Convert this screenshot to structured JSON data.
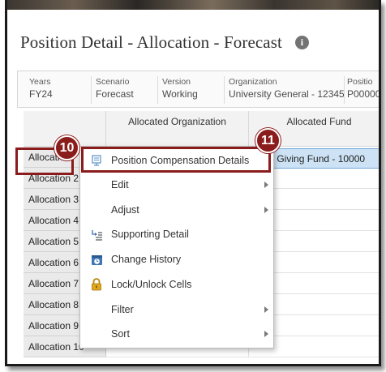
{
  "page_title": "Position Detail - Allocation - Forecast",
  "pov": [
    {
      "label": "Years",
      "value": "FY24"
    },
    {
      "label": "Scenario",
      "value": "Forecast"
    },
    {
      "label": "Version",
      "value": "Working"
    },
    {
      "label": "Organization",
      "value": "University General - 12345"
    },
    {
      "label": "Positio",
      "value": "P00000"
    }
  ],
  "grid": {
    "columns": [
      "Allocated Organization",
      "Allocated Fund"
    ],
    "rows": [
      "Allocatio",
      "Allocation 2",
      "Allocation 3",
      "Allocation 4",
      "Allocation 5",
      "Allocation 6",
      "Allocation 7",
      "Allocation 8",
      "Allocation 9",
      "Allocation 10"
    ],
    "selected_cell_value": "ual Giving Fund - 10000"
  },
  "callouts": [
    "10",
    "11"
  ],
  "context_menu": [
    {
      "label": "Position Compensation Details",
      "icon": "position-details-icon",
      "submenu": false
    },
    {
      "label": "Edit",
      "icon": "",
      "submenu": true
    },
    {
      "label": "Adjust",
      "icon": "",
      "submenu": true
    },
    {
      "label": "Supporting Detail",
      "icon": "supporting-detail-icon",
      "submenu": false
    },
    {
      "label": "Change History",
      "icon": "change-history-icon",
      "submenu": false
    },
    {
      "label": "Lock/Unlock Cells",
      "icon": "lock-icon",
      "submenu": false
    },
    {
      "label": "Filter",
      "icon": "",
      "submenu": true
    },
    {
      "label": "Sort",
      "icon": "",
      "submenu": true
    }
  ],
  "colors": {
    "callout": "#8b1c1c",
    "selection": "#cde3f5"
  }
}
